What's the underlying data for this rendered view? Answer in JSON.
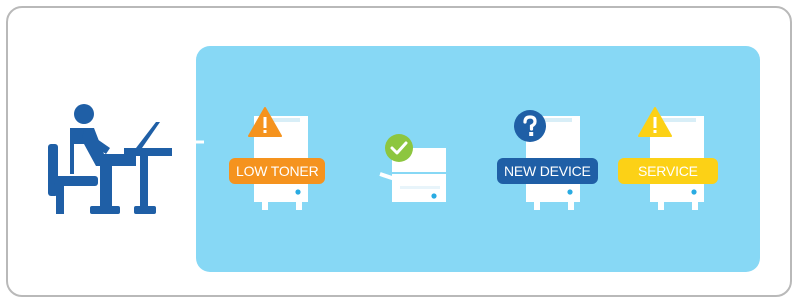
{
  "colors": {
    "panel": "#87d8f5",
    "worker": "#1f5fa6",
    "printer_body": "#ffffff",
    "warning": "#f5931e",
    "ok": "#8dc63f",
    "info": "#1f5fa6",
    "service": "#fcd116"
  },
  "icons": {
    "worker": "person-at-laptop-icon",
    "printer": "printer-icon",
    "low_toner": "warning-triangle-icon",
    "ok": "check-circle-icon",
    "new_device": "question-circle-icon",
    "service": "warning-triangle-icon"
  },
  "devices": [
    {
      "id": "low-toner",
      "status_label": "LOW TONER"
    },
    {
      "id": "ok",
      "status_label": ""
    },
    {
      "id": "new-device",
      "status_label": "NEW DEVICE"
    },
    {
      "id": "service",
      "status_label": "SERVICE"
    }
  ]
}
